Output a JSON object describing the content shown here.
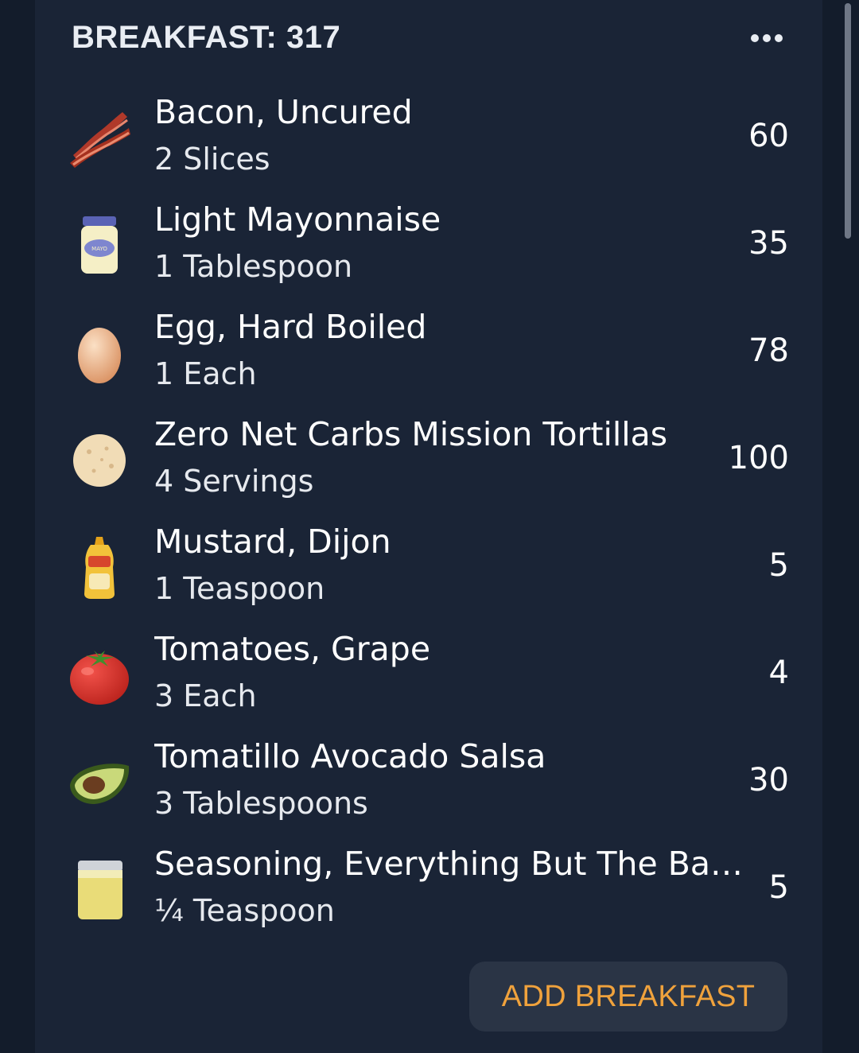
{
  "header": {
    "title": "BREAKFAST: 317",
    "more_icon": "more-horizontal-icon"
  },
  "items": [
    {
      "name": "Bacon, Uncured",
      "serving": "2 Slices",
      "calories": "60",
      "icon": "bacon-icon"
    },
    {
      "name": "Light Mayonnaise",
      "serving": "1 Tablespoon",
      "calories": "35",
      "icon": "mayonnaise-jar-icon"
    },
    {
      "name": "Egg, Hard Boiled",
      "serving": "1 Each",
      "calories": "78",
      "icon": "egg-icon"
    },
    {
      "name": "Zero Net Carbs Mission Tortillas",
      "serving": "4 Servings",
      "calories": "100",
      "icon": "tortilla-icon"
    },
    {
      "name": "Mustard, Dijon",
      "serving": "1 Teaspoon",
      "calories": "5",
      "icon": "mustard-bottle-icon"
    },
    {
      "name": "Tomatoes, Grape",
      "serving": "3 Each",
      "calories": "4",
      "icon": "tomato-icon"
    },
    {
      "name": "Tomatillo Avocado Salsa",
      "serving": "3 Tablespoons",
      "calories": "30",
      "icon": "avocado-icon"
    },
    {
      "name": "Seasoning, Everything But The Bag…",
      "serving": "¼ Teaspoon",
      "calories": "5",
      "icon": "spice-jar-icon"
    }
  ],
  "add_button": {
    "label": "ADD BREAKFAST"
  },
  "colors": {
    "background": "#131c2b",
    "card": "#1a2436",
    "accent": "#f0a23c",
    "button_bg": "#2a3445"
  }
}
